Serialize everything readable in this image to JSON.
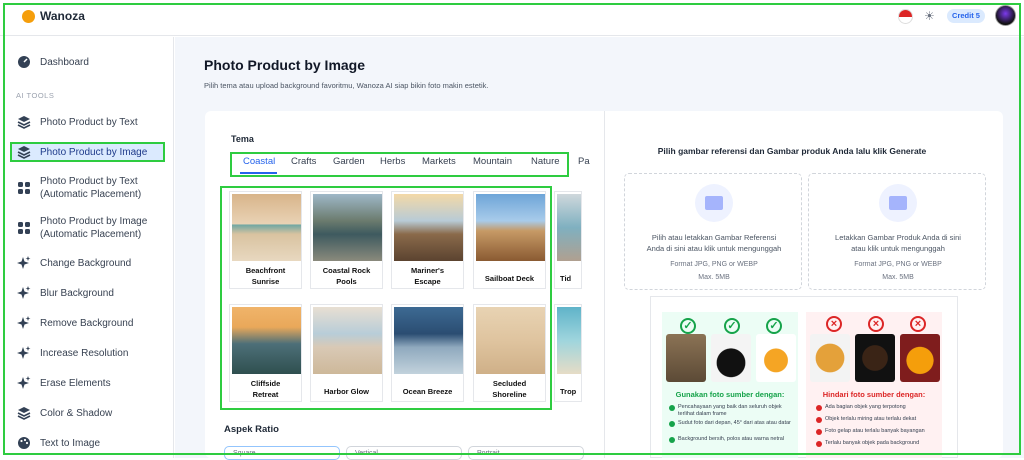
{
  "app": {
    "name": "Wanoza"
  },
  "header": {
    "credit": "Credit 5"
  },
  "sidebar": {
    "dashboard": "Dashboard",
    "section": "AI TOOLS",
    "items": [
      {
        "label": "Photo Product by Text",
        "icon": "layers-icon"
      },
      {
        "label": "Photo Product by Image",
        "icon": "layers-icon",
        "active": true
      },
      {
        "label": "Photo Product by Text",
        "label2": "(Automatic Placement)",
        "icon": "grid-icon"
      },
      {
        "label": "Photo Product by Image",
        "label2": "(Automatic Placement)",
        "icon": "grid-icon"
      },
      {
        "label": "Change Background",
        "icon": "sparkle-icon"
      },
      {
        "label": "Blur Background",
        "icon": "sparkle-icon"
      },
      {
        "label": "Remove Background",
        "icon": "sparkle-icon"
      },
      {
        "label": "Increase Resolution",
        "icon": "sparkle-icon"
      },
      {
        "label": "Erase Elements",
        "icon": "sparkle-icon"
      },
      {
        "label": "Color & Shadow",
        "icon": "layers-icon"
      },
      {
        "label": "Text to Image",
        "icon": "palette-icon"
      }
    ]
  },
  "page": {
    "title": "Photo Product by Image",
    "subtitle": "Pilih tema atau upload background favoritmu, Wanoza AI siap bikin foto makin estetik."
  },
  "tema": {
    "label": "Tema",
    "tabs": [
      "Coastal",
      "Crafts",
      "Garden",
      "Herbs",
      "Markets",
      "Mountain",
      "Nature",
      "Pa"
    ],
    "selected": "Coastal",
    "tiles": [
      {
        "l1": "Beachfront",
        "l2": "Sunrise"
      },
      {
        "l1": "Coastal Rock",
        "l2": "Pools"
      },
      {
        "l1": "Mariner's",
        "l2": "Escape"
      },
      {
        "l1": "Sailboat Deck",
        "l2": ""
      },
      {
        "l1": "Tid",
        "l2": ""
      },
      {
        "l1": "Cliffside",
        "l2": "Retreat"
      },
      {
        "l1": "Harbor Glow",
        "l2": ""
      },
      {
        "l1": "Ocean Breeze",
        "l2": ""
      },
      {
        "l1": "Secluded",
        "l2": "Shoreline"
      },
      {
        "l1": "Trop",
        "l2": ""
      }
    ],
    "aspek": "Aspek Ratio",
    "ratio_options": [
      "Square",
      "Vertical",
      "Portrait"
    ]
  },
  "right": {
    "title": "Pilih gambar referensi dan Gambar produk Anda lalu klik Generate",
    "ref": {
      "line1": "Pilih atau letakkan Gambar Referensi",
      "line2": "Anda di sini atau klik untuk mengunggah",
      "format": "Format JPG, PNG or WEBP",
      "max": "Max. 5MB"
    },
    "prod": {
      "line1": "Letakkan Gambar Produk Anda di sini",
      "line2": "atau klik untuk mengunggah",
      "format": "Format JPG, PNG or WEBP",
      "max": "Max. 5MB"
    },
    "good": {
      "head": "Gunakan foto sumber dengan:",
      "lines": [
        "Pencahayaan yang baik dan seluruh objek terlihat dalam frame",
        "Sudut foto dari depan, 45° dari atas atau datar",
        "Background bersih, polos atau warna netral"
      ]
    },
    "bad": {
      "head": "Hindari foto sumber dengan:",
      "lines": [
        "Ada bagian objek yang terpotong",
        "Objek terlalu miring atau terlalu dekat",
        "Foto gelap atau terlalu banyak bayangan",
        "Terlalu banyak objek pada background"
      ]
    }
  },
  "colors": {
    "accent": "#2563eb",
    "highlight": "#2ecc40",
    "active_bg": "#dbeafe"
  }
}
